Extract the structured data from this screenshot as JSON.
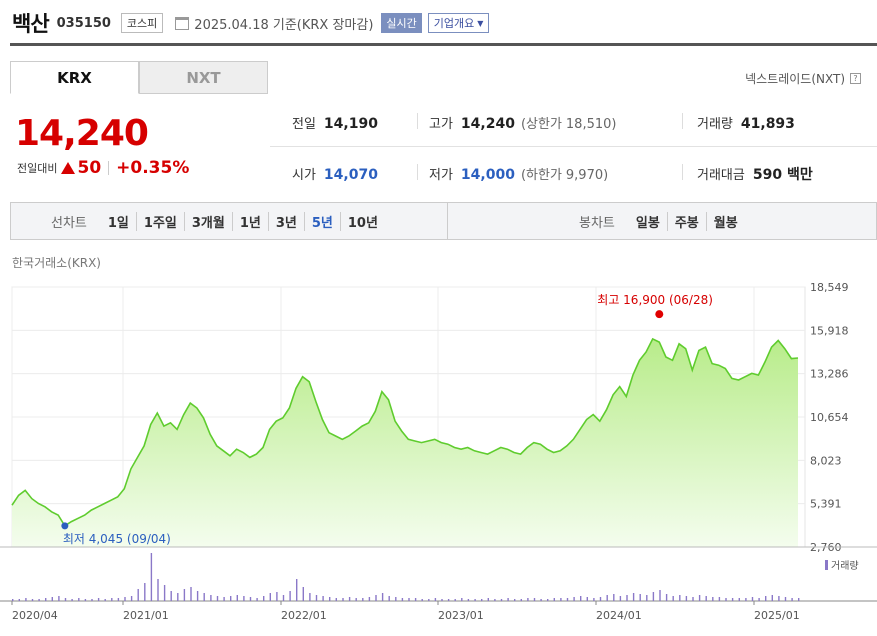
{
  "header": {
    "stock_name": "백산",
    "stock_code": "035150",
    "market": "코스피",
    "date_text": "2025.04.18 기준(KRX 장마감)",
    "realtime_label": "실시간",
    "company_label": "기업개요"
  },
  "exchange_tabs": [
    {
      "label": "KRX",
      "active": true
    },
    {
      "label": "NXT",
      "active": false
    }
  ],
  "nxt_link": "넥스트레이드(NXT)",
  "quote": {
    "price": "14,240",
    "change_label": "전일대비",
    "change_value": "50",
    "change_pct": "+0.35%"
  },
  "stats": {
    "prev_close": {
      "label": "전일",
      "value": "14,190"
    },
    "high": {
      "label": "고가",
      "value": "14,240",
      "sub_label": "(상한가",
      "sub_value": "18,510)"
    },
    "volume": {
      "label": "거래량",
      "value": "41,893"
    },
    "open": {
      "label": "시가",
      "value": "14,070"
    },
    "low": {
      "label": "저가",
      "value": "14,000",
      "sub_label": "(하한가",
      "sub_value": "9,970)"
    },
    "amount": {
      "label": "거래대금",
      "value": "590 백만"
    }
  },
  "period_bar": {
    "line_title": "선차트",
    "line_items": [
      {
        "label": "1일",
        "active": false
      },
      {
        "label": "1주일",
        "active": false
      },
      {
        "label": "3개월",
        "active": false
      },
      {
        "label": "1년",
        "active": false
      },
      {
        "label": "3년",
        "active": false
      },
      {
        "label": "5년",
        "active": true
      },
      {
        "label": "10년",
        "active": false
      }
    ],
    "candle_title": "봉차트",
    "candle_items": [
      {
        "label": "일봉"
      },
      {
        "label": "주봉"
      },
      {
        "label": "월봉"
      }
    ]
  },
  "chart_caption": "한국거래소(KRX)",
  "volume_label": "거래량",
  "colors": {
    "up": "#d60000",
    "blue": "#2b5fbf",
    "line": "#5fcc2e",
    "fill_top": "#b8ec8a",
    "volume": "#8a78c8"
  },
  "chart_data": {
    "type": "area",
    "y_ticks": [
      "18,549",
      "15,918",
      "13,286",
      "10,654",
      "8,023",
      "5,391",
      "2,760"
    ],
    "ylim": [
      2760,
      18549
    ],
    "x_ticks": [
      "2020/04",
      "2021/01",
      "2022/01",
      "2023/01",
      "2024/01",
      "2025/01"
    ],
    "high": {
      "label": "최고 16,900 (06/28)",
      "value": 16900
    },
    "low": {
      "label": "최저 4,045 (09/04)",
      "value": 4045
    },
    "series": [
      5300,
      5900,
      6200,
      5700,
      5400,
      5200,
      4900,
      4700,
      4045,
      4300,
      4500,
      4700,
      5000,
      5200,
      5400,
      5600,
      5800,
      6300,
      7500,
      8200,
      8900,
      10200,
      10900,
      10100,
      10300,
      9900,
      10800,
      11500,
      11200,
      10600,
      9600,
      8900,
      8600,
      8300,
      8700,
      8500,
      8200,
      8400,
      8800,
      9900,
      10400,
      10600,
      11200,
      12400,
      13100,
      12800,
      11600,
      10500,
      9700,
      9500,
      9300,
      9500,
      9800,
      10100,
      10300,
      11000,
      12200,
      11700,
      10400,
      9800,
      9300,
      9200,
      9100,
      9200,
      9300,
      9100,
      9000,
      8800,
      8700,
      8800,
      8600,
      8500,
      8400,
      8600,
      8800,
      8700,
      8500,
      8400,
      8800,
      9100,
      9000,
      8700,
      8500,
      8600,
      8900,
      9300,
      9900,
      10500,
      10800,
      10400,
      11100,
      12000,
      12500,
      11900,
      13200,
      14100,
      14600,
      15400,
      15200,
      14300,
      14100,
      15100,
      14800,
      13500,
      14700,
      14900,
      13900,
      13800,
      13600,
      13000,
      12900,
      13100,
      13300,
      13200,
      14000,
      14900,
      15300,
      14800,
      14200,
      14240
    ]
  }
}
